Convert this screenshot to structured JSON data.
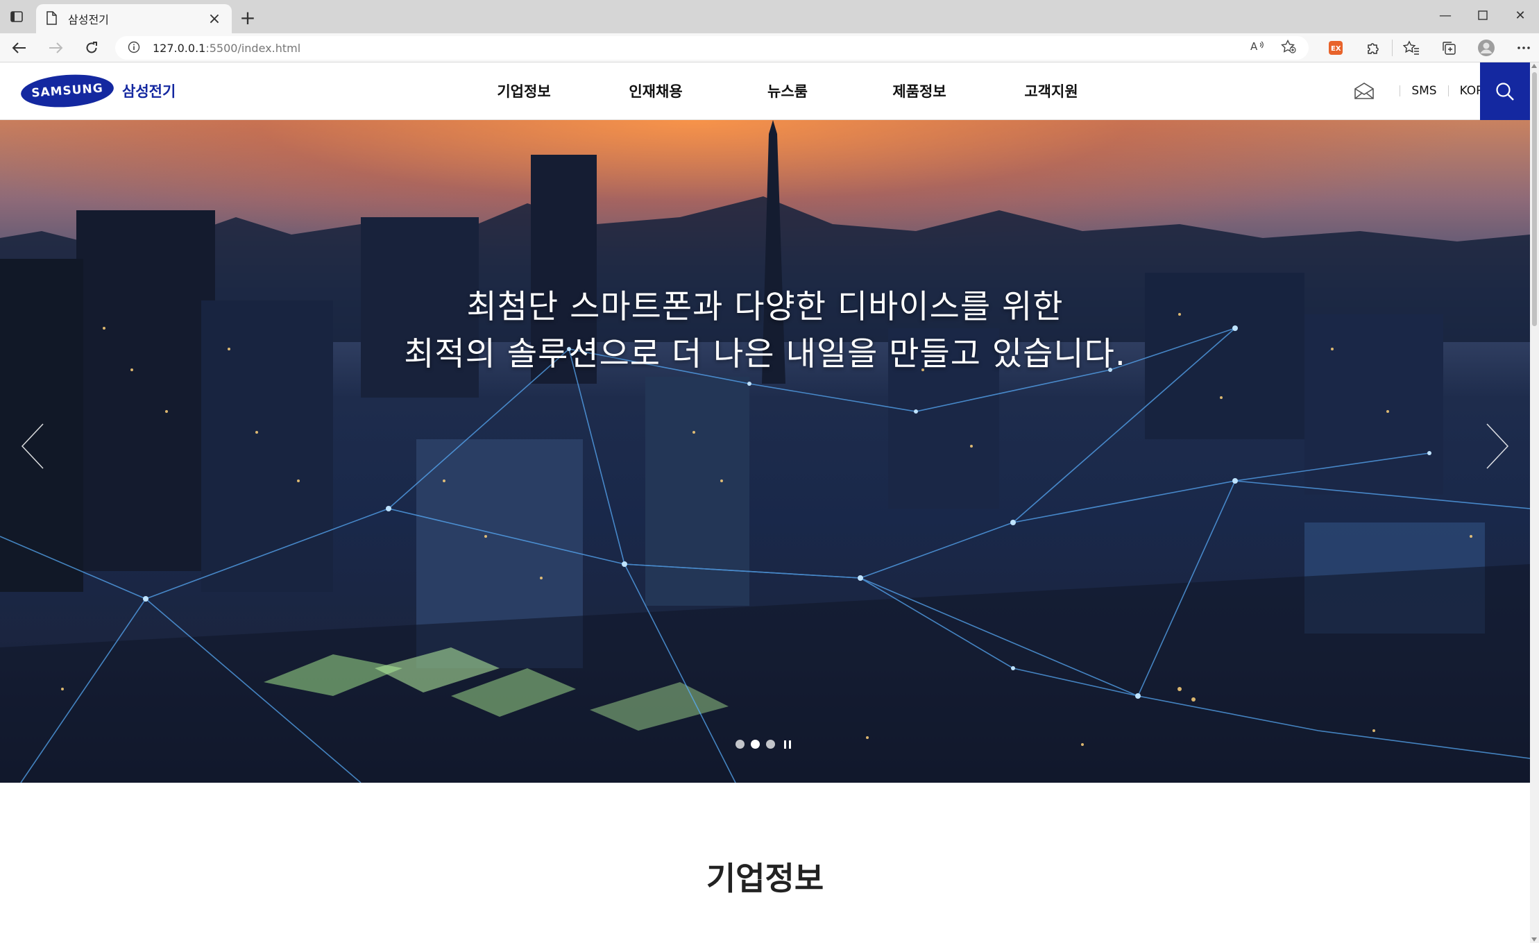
{
  "browser": {
    "tab_title": "삼성전기",
    "url_host": "127.0.0.1",
    "url_rest": ":5500/index.html"
  },
  "header": {
    "logo_mark": "SAMSUNG",
    "logo_text": "삼성전기",
    "nav": [
      "기업정보",
      "인재채용",
      "뉴스룸",
      "제품정보",
      "고객지원"
    ],
    "util_links": [
      "SMS",
      "KOR"
    ]
  },
  "hero": {
    "line1": "최첨단 스마트폰과 다양한 디바이스를 위한",
    "line2": "최적의 솔루션으로 더 나은 내일을 만들고 있습니다.",
    "slides_total": 3,
    "active_slide": 2
  },
  "sections": {
    "company_title": "기업정보"
  },
  "colors": {
    "brand": "#1428a0",
    "tabbar": "#d6d6d6",
    "toolbar": "#f7f7f7"
  }
}
